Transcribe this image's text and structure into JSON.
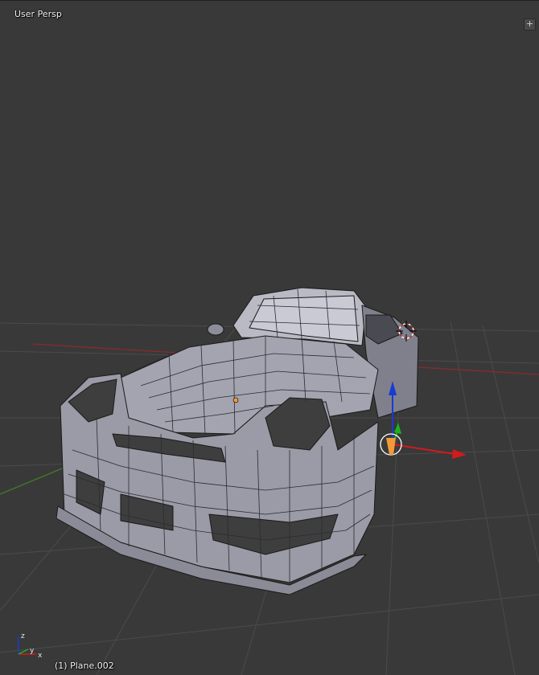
{
  "viewport": {
    "view_label": "User Persp",
    "object_label": "(1) Plane.002",
    "toggle_label": "+"
  },
  "mini_axes": {
    "z_label": "z",
    "y_label": "y",
    "x_label": "x"
  },
  "colors": {
    "background": "#393939",
    "grid": "#4b4b4b",
    "x_axis": "#8a2b2b",
    "y_axis": "#3f7a2a",
    "mesh_fill": "#9fa0ab",
    "mesh_edge": "#1a1a1a",
    "gizmo_x": "#d41a1a",
    "gizmo_y": "#1ab41a",
    "gizmo_z": "#1a3ad4",
    "cursor": "#d42020",
    "origin": "#f29a3a"
  },
  "icons": [
    "3d-cursor-icon",
    "transform-gizmo-icon",
    "object-origin-icon",
    "axis-orientation-icon",
    "add-toggle-icon"
  ]
}
